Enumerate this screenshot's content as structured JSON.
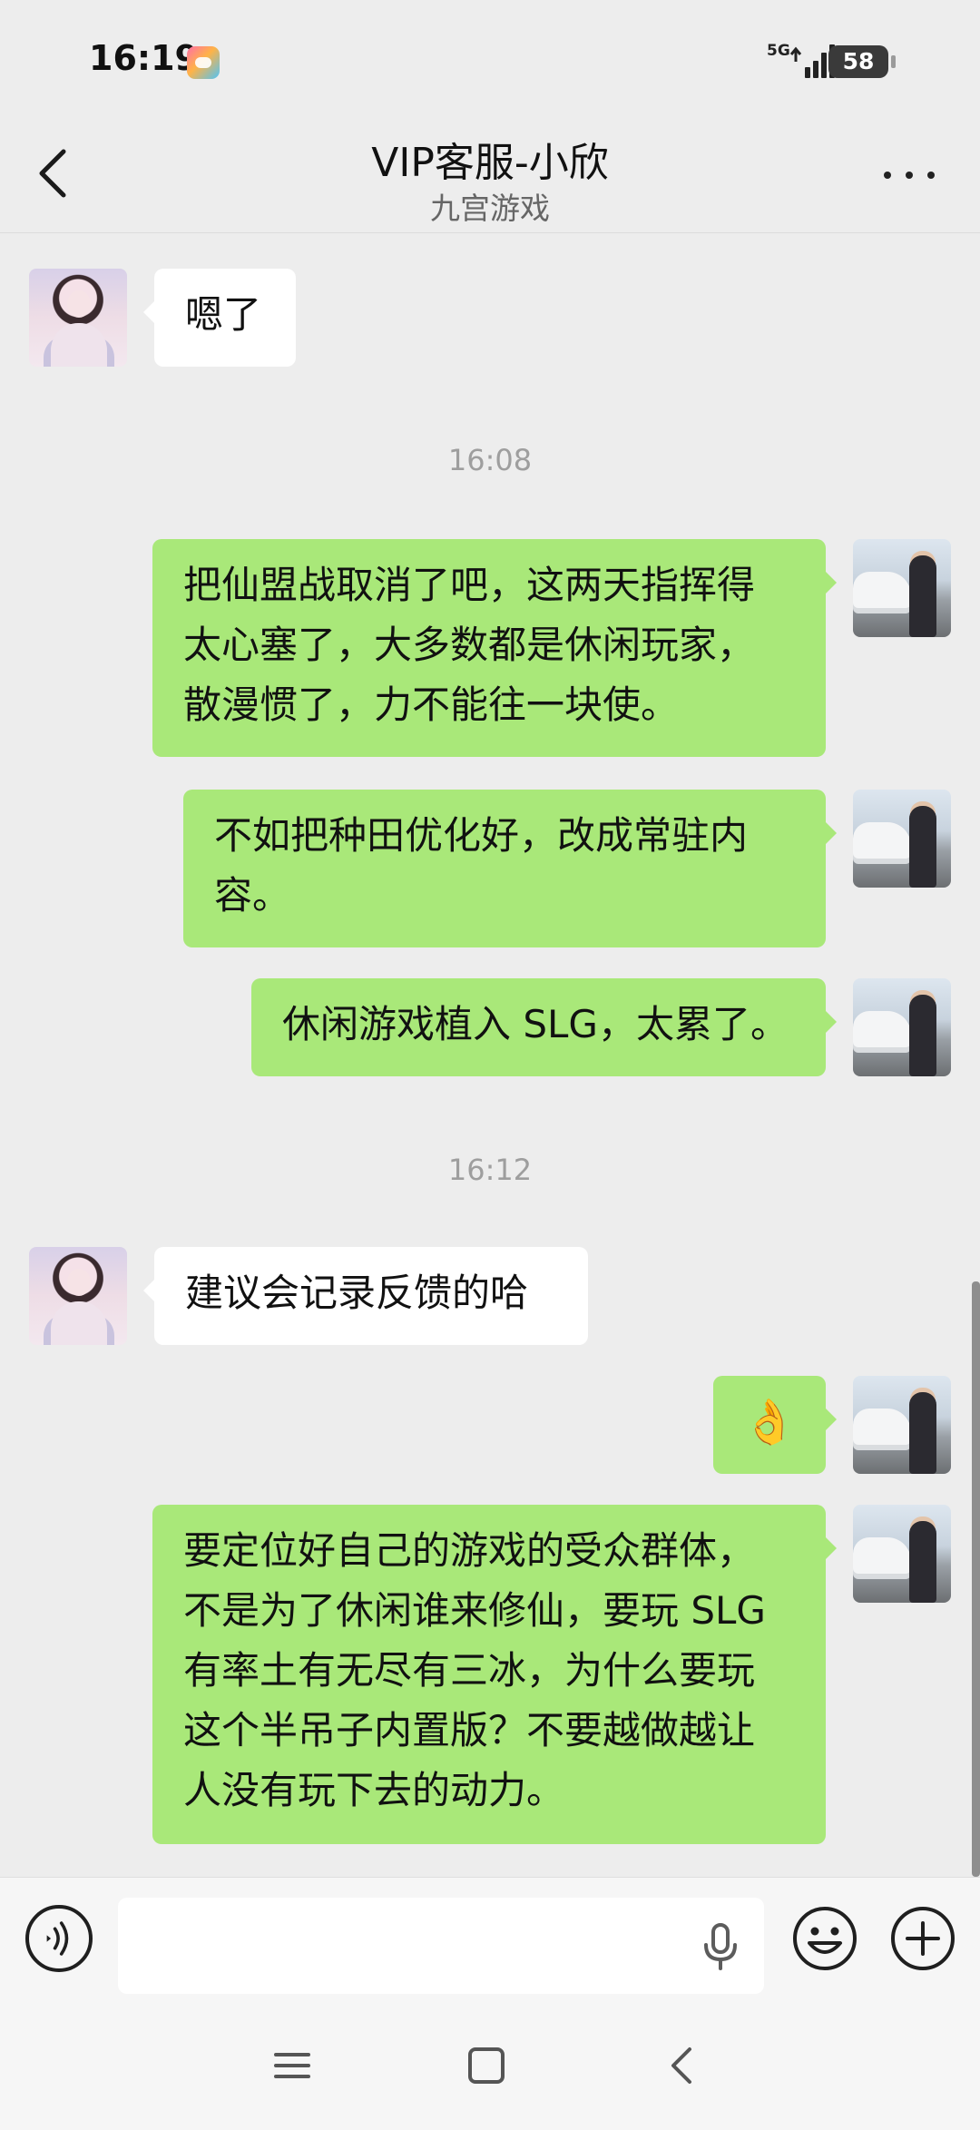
{
  "status_bar": {
    "time": "16:19",
    "network": "5G",
    "battery": "58"
  },
  "header": {
    "title": "VIP客服-小欣",
    "subtitle": "九宫游戏",
    "back_icon": "chevron-left-icon",
    "more_icon": "more-dots-icon"
  },
  "messages": [
    {
      "side": "in",
      "text": "嗯了"
    },
    {
      "timestamp": "16:08"
    },
    {
      "side": "out",
      "lines": [
        "把仙盟战取消了吧，这两天指挥得",
        "太心塞了，大多数都是休闲玩家，",
        "散漫惯了，力不能往一块使。"
      ]
    },
    {
      "side": "out",
      "lines": [
        "不如把种田优化好，改成常驻内",
        "容。"
      ]
    },
    {
      "side": "out",
      "text": "休闲游戏植入 SLG，太累了。"
    },
    {
      "timestamp": "16:12"
    },
    {
      "side": "in",
      "text": "建议会记录反馈的哈"
    },
    {
      "side": "out",
      "emoji": "👌"
    },
    {
      "side": "out",
      "lines": [
        "要定位好自己的游戏的受众群体，",
        "不是为了休闲谁来修仙，要玩 SLG",
        "有率土有无尽有三冰，为什么要玩",
        "这个半吊子内置版？不要越做越让",
        "人没有玩下去的动力。"
      ]
    }
  ],
  "input_bar": {
    "placeholder": "",
    "voice_icon": "voice-icon",
    "mic_icon": "microphone-icon",
    "emoji_icon": "emoji-icon",
    "plus_icon": "plus-icon"
  },
  "colors": {
    "background": "#ededed",
    "outgoing_bubble": "#a9e879",
    "incoming_bubble": "#ffffff",
    "timestamp": "#9e9e9e"
  }
}
